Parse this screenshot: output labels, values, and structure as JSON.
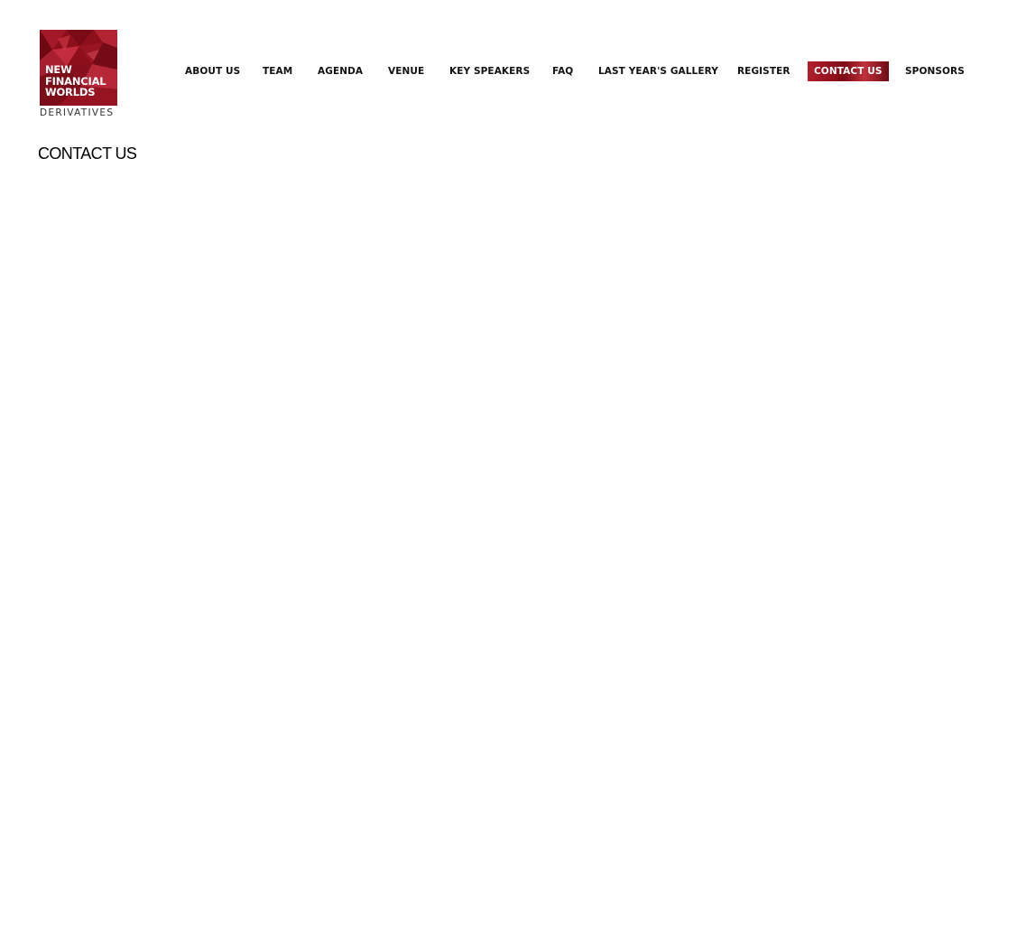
{
  "logo": {
    "lines": [
      "NEW",
      "FINANCIAL",
      "WORLDS"
    ],
    "subtitle": "DERIVATIVES",
    "brand_color": "#8e0f1c"
  },
  "nav": {
    "items": [
      {
        "label": "ABOUT US"
      },
      {
        "label": "TEAM"
      },
      {
        "label": "AGENDA"
      },
      {
        "label": "VENUE"
      },
      {
        "label": "KEY SPEAKERS"
      },
      {
        "label": "FAQ"
      },
      {
        "label": "LAST YEAR'S GALLERY"
      },
      {
        "label": "REGISTER"
      },
      {
        "label": "CONTACT US",
        "active": true
      },
      {
        "label": "SPONSORS"
      }
    ],
    "active_color": "#9b1420"
  },
  "page": {
    "title": "CONTACT US"
  }
}
